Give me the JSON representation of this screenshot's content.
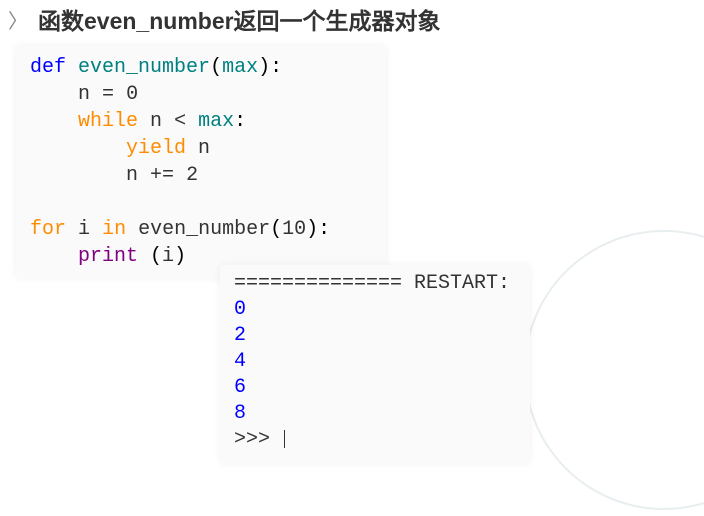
{
  "heading": {
    "chevron": "〉",
    "title": "函数even_number返回一个生成器对象"
  },
  "code": {
    "line1": {
      "def": "def",
      "fname": "even_number",
      "param": "max"
    },
    "line2": {
      "n": "n",
      "eq": "=",
      "zero": "0"
    },
    "line3": {
      "while": "while",
      "n": "n",
      "lt": "<",
      "max": "max"
    },
    "line4": {
      "yield": "yield",
      "n": "n"
    },
    "line5": {
      "n1": "n",
      "op": "+=",
      "two": "2"
    },
    "line6": {
      "for": "for",
      "i": "i",
      "in": "in",
      "fname": "even_number",
      "ten": "10"
    },
    "line7": {
      "print": "print",
      "i": "i"
    }
  },
  "output": {
    "restart": "============== RESTART:",
    "vals": [
      "0",
      "2",
      "4",
      "6",
      "8"
    ],
    "prompt": ">>> "
  }
}
